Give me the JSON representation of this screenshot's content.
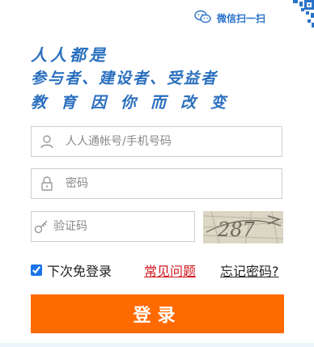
{
  "header": {
    "wechat_scan_label": "微信扫一扫",
    "wechat_icon": "wechat-icon",
    "qr_icon": "qr-code-icon"
  },
  "slogan": {
    "line1": "人人都是",
    "line2": "参与者、建设者、受益者",
    "line3": "教育因你而改变"
  },
  "form": {
    "username": {
      "placeholder": "人人通帐号/手机号码",
      "value": "",
      "icon": "user-icon"
    },
    "password": {
      "placeholder": "密码",
      "value": "",
      "icon": "lock-icon"
    },
    "captcha": {
      "placeholder": "验证码",
      "value": "",
      "icon": "key-icon",
      "image_text": "287"
    },
    "remember_label": "下次免登录",
    "remember_checked": true,
    "faq_link": "常见问题",
    "forgot_link": "忘记密码?",
    "login_label": "登录"
  },
  "colors": {
    "accent_blue": "#2a6fbe",
    "login_orange": "#ff6a00",
    "faq_red": "#d0151b"
  }
}
